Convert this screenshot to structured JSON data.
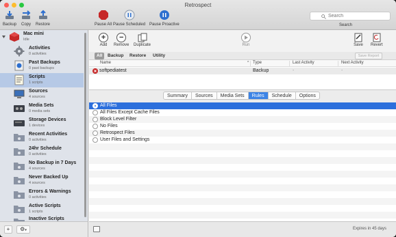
{
  "window": {
    "title": "Retrospect"
  },
  "toolbar": {
    "backup": "Backup",
    "copy": "Copy",
    "restore": "Restore",
    "pause_all": "Pause All",
    "pause_scheduled": "Pause Scheduled",
    "pause_proactive": "Pause Proactive",
    "search_placeholder": "Search",
    "search_label": "Search"
  },
  "sidebar": {
    "items": [
      {
        "name": "Mac mini",
        "sub": "Idle"
      },
      {
        "name": "Activities",
        "sub": "0 activities"
      },
      {
        "name": "Past Backups",
        "sub": "0 past backups"
      },
      {
        "name": "Scripts",
        "sub": "1 scripts"
      },
      {
        "name": "Sources",
        "sub": "4 sources"
      },
      {
        "name": "Media Sets",
        "sub": "0 media sets"
      },
      {
        "name": "Storage Devices",
        "sub": "1 devices"
      },
      {
        "name": "Recent Activities",
        "sub": "0 activities"
      },
      {
        "name": "24hr Schedule",
        "sub": "0 activities"
      },
      {
        "name": "No Backup in 7 Days",
        "sub": "4 sources"
      },
      {
        "name": "Never Backed Up",
        "sub": "4 sources"
      },
      {
        "name": "Errors & Warnings",
        "sub": "0 activities"
      },
      {
        "name": "Active Scripts",
        "sub": "1 scripts"
      },
      {
        "name": "Inactive Scripts",
        "sub": ""
      }
    ],
    "add": "+",
    "gear": "⚙"
  },
  "main_toolbar": {
    "add": "Add",
    "remove": "Remove",
    "duplicate": "Duplicate",
    "run": "Run",
    "save": "Save",
    "revert": "Revert"
  },
  "filters": {
    "all": "All",
    "backup": "Backup",
    "restore": "Restore",
    "utility": "Utility",
    "save_report": "Save Report"
  },
  "table": {
    "headers": {
      "name": "Name",
      "type": "Type",
      "last_activity": "Last Activity",
      "next_activity": "Next Activity"
    },
    "rows": [
      {
        "name": "softpediatest",
        "type": "Backup",
        "last": "-",
        "next": "-"
      }
    ]
  },
  "tabs": [
    "Summary",
    "Sources",
    "Media Sets",
    "Rules",
    "Schedule",
    "Options"
  ],
  "rules": [
    "All Files",
    "All Files Except Cache Files",
    "Block Level Filter",
    "No Files",
    "Retrospect Files",
    "User Files and Settings"
  ],
  "status": {
    "expires": "Expires in 45 days"
  },
  "colors": {
    "accent": "#2c6fdc",
    "tab_active": "#3d84e6",
    "sidebar_selected": "#b6c9e6",
    "error_red": "#c62828"
  }
}
